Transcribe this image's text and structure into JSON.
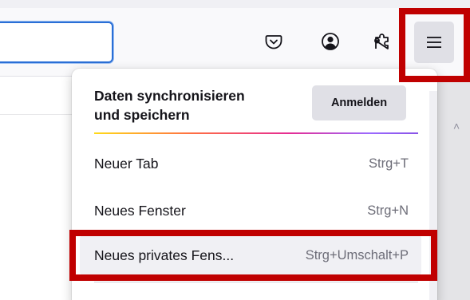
{
  "toolbar": {
    "url_value": "",
    "icons": {
      "pocket": "pocket-icon",
      "account": "account-icon",
      "extensions": "puzzle-icon",
      "menu": "hamburger-menu-icon"
    }
  },
  "menu": {
    "sync": {
      "title_line1": "Daten synchronisieren",
      "title_line2": "und speichern",
      "signin_label": "Anmelden"
    },
    "items": [
      {
        "label": "Neuer Tab",
        "shortcut": "Strg+T"
      },
      {
        "label": "Neues Fenster",
        "shortcut": "Strg+N"
      },
      {
        "label": "Neues privates Fens...",
        "shortcut": "Strg+Umschalt+P"
      }
    ]
  },
  "colors": {
    "annotation_red": "#c00000",
    "focus_blue": "#2a6fd6",
    "toolbar_bg": "#f9f9fb",
    "button_bg": "#e0e0e6"
  }
}
